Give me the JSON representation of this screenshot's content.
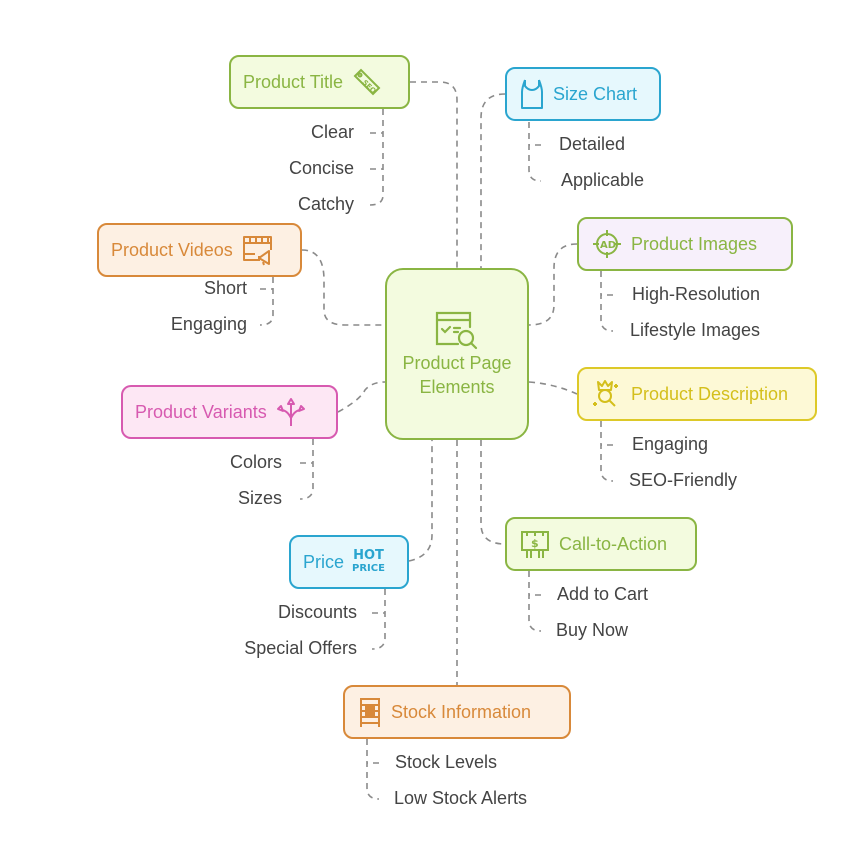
{
  "center": {
    "label": "Product Page Elements",
    "icon": "webpage-search-icon"
  },
  "branches": {
    "product_title": {
      "label": "Product Title",
      "icon": "seo-tag-icon",
      "color": "#8ab543",
      "items": [
        "Clear",
        "Concise",
        "Catchy"
      ]
    },
    "size_chart": {
      "label": "Size Chart",
      "icon": "tank-top-icon",
      "color": "#2aa5cf",
      "items": [
        "Detailed",
        "Applicable"
      ]
    },
    "product_videos": {
      "label": "Product Videos",
      "icon": "video-megaphone-icon",
      "color": "#d8893a",
      "items": [
        "Short",
        "Engaging"
      ]
    },
    "product_images": {
      "label": "Product Images",
      "icon": "ad-target-icon",
      "color": "#8ab543",
      "items": [
        "High-Resolution",
        "Lifestyle Images"
      ]
    },
    "product_variants": {
      "label": "Product Variants",
      "icon": "branching-arrows-icon",
      "color": "#d75ab0",
      "items": [
        "Colors",
        "Sizes"
      ]
    },
    "product_description": {
      "label": "Product Description",
      "icon": "crown-search-icon",
      "color": "#d4bf1c",
      "items": [
        "Engaging",
        "SEO-Friendly"
      ]
    },
    "price": {
      "label": "Price",
      "icon": "hot-price-icon",
      "icon_text": [
        "HOT",
        "PRICE"
      ],
      "color": "#2aa5cf",
      "items": [
        "Discounts",
        "Special Offers"
      ]
    },
    "call_to_action": {
      "label": "Call-to-Action",
      "icon": "billboard-dollar-icon",
      "color": "#8ab543",
      "items": [
        "Add to Cart",
        "Buy Now"
      ]
    },
    "stock_information": {
      "label": "Stock Information",
      "icon": "cabinet-icon",
      "color": "#d8893a",
      "items": [
        "Stock Levels",
        "Low Stock Alerts"
      ]
    }
  }
}
